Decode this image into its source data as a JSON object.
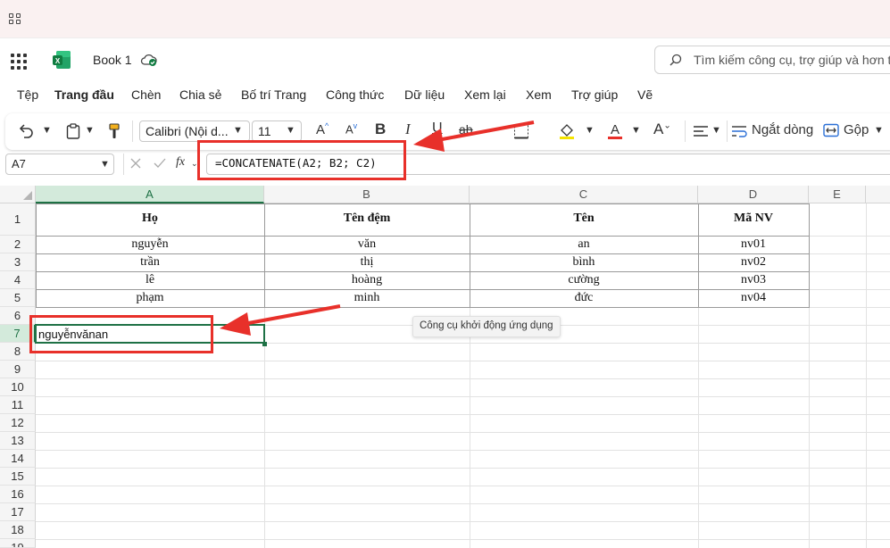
{
  "app": {
    "title": "Book 1"
  },
  "search": {
    "placeholder": "Tìm kiếm công cụ, trợ giúp và hơn t"
  },
  "menu": [
    "Tệp",
    "Trang đầu",
    "Chèn",
    "Chia sẻ",
    "Bố trí Trang",
    "Công thức",
    "Dữ liệu",
    "Xem lại",
    "Xem",
    "Trợ giúp",
    "Vẽ"
  ],
  "menu_active": "Trang đầu",
  "ribbon": {
    "font_name": "Calibri (Nội d...",
    "font_size": "11",
    "wrap_label": "Ngắt dòng",
    "merge_label": "Gộp"
  },
  "formula_bar": {
    "name_box": "A7",
    "fx": "fx",
    "formula": "=CONCATENATE(A2; B2; C2)"
  },
  "sheet": {
    "columns": [
      "A",
      "B",
      "C",
      "D",
      "E"
    ],
    "rows": [
      "1",
      "2",
      "3",
      "4",
      "5",
      "6",
      "7",
      "8",
      "9",
      "10",
      "11",
      "12",
      "13",
      "14",
      "15",
      "16",
      "17",
      "18",
      "19"
    ],
    "header": [
      "Họ",
      "Tên đệm",
      "Tên",
      "Mã NV"
    ],
    "data": [
      [
        "nguyễn",
        "văn",
        "an",
        "nv01"
      ],
      [
        "trần",
        "thị",
        "bình",
        "nv02"
      ],
      [
        "lê",
        "hoàng",
        "cường",
        "nv03"
      ],
      [
        "phạm",
        "minh",
        "đức",
        "nv04"
      ]
    ],
    "active_cell_value": "nguyễnvănan"
  },
  "tooltip": "Công cụ khởi động ứng dụng",
  "colors": {
    "annotation": "#e8302a",
    "excel_green": "#107c41",
    "selection": "#1e7145"
  }
}
